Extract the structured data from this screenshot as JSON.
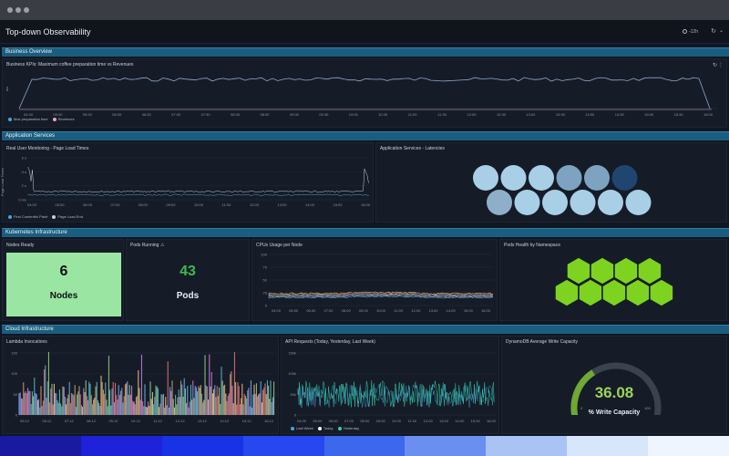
{
  "app": {
    "title": "Top-down Observability",
    "time_range": "-12h"
  },
  "sections": [
    {
      "id": "business",
      "title": "Business Overview"
    },
    {
      "id": "application",
      "title": "Application Services"
    },
    {
      "id": "kubernetes",
      "title": "Kubernetes Infrastructure"
    },
    {
      "id": "cloud",
      "title": "Cloud Infrastructure"
    }
  ],
  "panels": {
    "business_kpis": {
      "title": "Business KPIs: Maximum coffee preparation time vs Revenues",
      "ylabel": "ms",
      "x_ticks": [
        "04:30",
        "05:00",
        "05:30",
        "06:00",
        "06:30",
        "07:00",
        "07:30",
        "08:00",
        "08:30",
        "09:00",
        "09:30",
        "10:00",
        "10:30",
        "11:00",
        "11:30",
        "12:00",
        "12:30",
        "13:00",
        "13:30",
        "14:00",
        "14:30",
        "15:00",
        "15:30",
        "16:00"
      ],
      "legend": [
        {
          "label": "Max preparation time",
          "color": "#4ea3d8"
        },
        {
          "label": "Revenues",
          "color": "#e7a3c9"
        }
      ]
    },
    "rum": {
      "title": "Real User Monitoring - Page Load Times",
      "ylabel": "Page Load Times",
      "y_ticks": [
        "6 s",
        "4 s",
        "2 s",
        "0 ms"
      ],
      "x_ticks": [
        "04:00",
        "05:00",
        "06:00",
        "07:00",
        "08:00",
        "09:00",
        "10:00",
        "11:00",
        "12:00",
        "13:00",
        "14:00",
        "15:00",
        "16:00"
      ],
      "legend": [
        {
          "label": "First Contentful Paint",
          "color": "#4ea3d8"
        },
        {
          "label": "Page Load End",
          "color": "#c9d1d9"
        }
      ]
    },
    "latencies": {
      "title": "Application Services - Latencies",
      "hexes": [
        {
          "color": "#a9cfe6"
        },
        {
          "color": "#a9cfe6"
        },
        {
          "color": "#a9cfe6"
        },
        {
          "color": "#7da3c0"
        },
        {
          "color": "#7da3c0"
        },
        {
          "color": "#1f4570"
        },
        {
          "color": "#8eafc8"
        },
        {
          "color": "#a9cfe6"
        },
        {
          "color": "#a9cfe6"
        },
        {
          "color": "#a9cfe6"
        },
        {
          "color": "#a9cfe6"
        },
        {
          "color": "#a9cfe6"
        }
      ]
    },
    "nodes_ready": {
      "title": "Nodes Ready",
      "value": "6",
      "unit": "Nodes"
    },
    "pods_running": {
      "title": "Pods Running",
      "value": "43",
      "unit": "Pods"
    },
    "cpu_usage": {
      "title": "CPUs Usage per Node",
      "y_ticks": [
        "100",
        "75",
        "50",
        "25",
        "0"
      ],
      "x_ticks": [
        "04:00",
        "05:00",
        "06:00",
        "07:00",
        "08:00",
        "09:00",
        "10:00",
        "11:00",
        "12:00",
        "13:00",
        "14:00",
        "15:00",
        "16:00"
      ]
    },
    "pods_health": {
      "title": "Pods Health by Namespace",
      "hex_count": 9,
      "color": "#7ed321"
    },
    "lambda": {
      "title": "Lambda Invocations",
      "y_ticks": [
        "150",
        "100",
        "50",
        "0"
      ],
      "x_ticks": [
        "05:12",
        "06:12",
        "07:12",
        "08:12",
        "09:12",
        "10:12",
        "11:12",
        "12:12",
        "13:12",
        "14:12",
        "15:12",
        "16:12"
      ]
    },
    "api_requests": {
      "title": "API Requests (Today, Yesterday, Last Week)",
      "y_ticks": [
        "150k",
        "100k",
        "50k",
        "0"
      ],
      "x_ticks": [
        "04:00",
        "05:00",
        "06:00",
        "07:00",
        "08:00",
        "09:00",
        "10:00",
        "11:00",
        "12:00",
        "13:00",
        "14:00",
        "15:00",
        "16:00"
      ],
      "legend": [
        {
          "label": "Last Week",
          "color": "#4ea3d8"
        },
        {
          "label": "Today",
          "color": "#ffffff"
        },
        {
          "label": "Yesterday",
          "color": "#2ed3a8"
        }
      ]
    },
    "dynamodb": {
      "title": "DynamoDB Average Write Capacity",
      "value": "36.08",
      "value_fraction": 0.36,
      "unit": "% Write Capacity",
      "min": "0",
      "max": "100"
    }
  },
  "footer_colors": [
    "#1a1aa0",
    "#1e22d8",
    "#1833e6",
    "#2747ef",
    "#3d67ec",
    "#6a8ff0",
    "#a9c3f5",
    "#d8e6fb",
    "#eef5fe"
  ]
}
